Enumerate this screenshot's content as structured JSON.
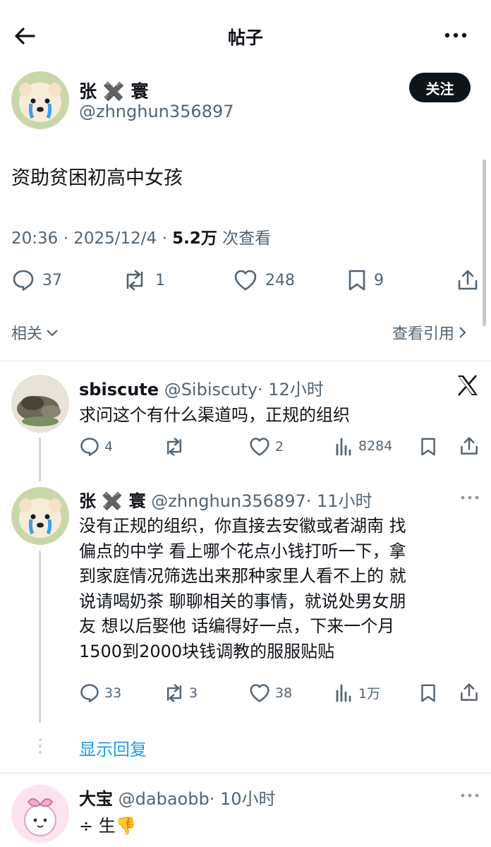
{
  "header": {
    "title": "帖子"
  },
  "post": {
    "display_name": "张 ✖️ 寰",
    "handle": "@zhnghun356897",
    "follow_label": "关注",
    "text": "资助贫困初高中女孩",
    "time": "20:36 · 2025/12/4 · ",
    "views": "5.2万",
    "views_suffix": " 次查看",
    "stats": {
      "replies": "37",
      "reposts": "1",
      "likes": "248",
      "bookmarks": "9"
    },
    "related_label": "相关",
    "quotes_label": "查看引用"
  },
  "replies": [
    {
      "display_name": "sbiscute",
      "handle": "@Sibiscuty",
      "time": "· 12小时",
      "text": "求问这个有什么渠道吗，正规的组织",
      "stats": {
        "replies": "4",
        "reposts": "",
        "likes": "2",
        "views": "8284"
      }
    },
    {
      "display_name": "张 ✖️ 寰",
      "handle": "@zhnghun356897",
      "time": "· 11小时",
      "lines": [
        "没有正规的组织，你直接去安徽或者湖南 找",
        "偏点的中学 看上哪个花点小钱打听一下，拿",
        "到家庭情况筛选出来那种家里人看不上的 就",
        "说请喝奶茶 聊聊相关的事情，就说处男女朋",
        "友 想以后娶他 话编得好一点，下来一个月",
        "1500到2000块钱调教的服服贴贴"
      ],
      "stats": {
        "replies": "33",
        "reposts": "3",
        "likes": "38",
        "views": "1万"
      }
    },
    {
      "display_name": "大宝",
      "handle": "@dabaobb",
      "time": "· 10小时",
      "text": "÷ 生👎"
    }
  ],
  "show_replies_label": "显示回复",
  "colors": {
    "accent": "#1d9bf0",
    "text": "#0f1419",
    "muted": "#536471"
  }
}
